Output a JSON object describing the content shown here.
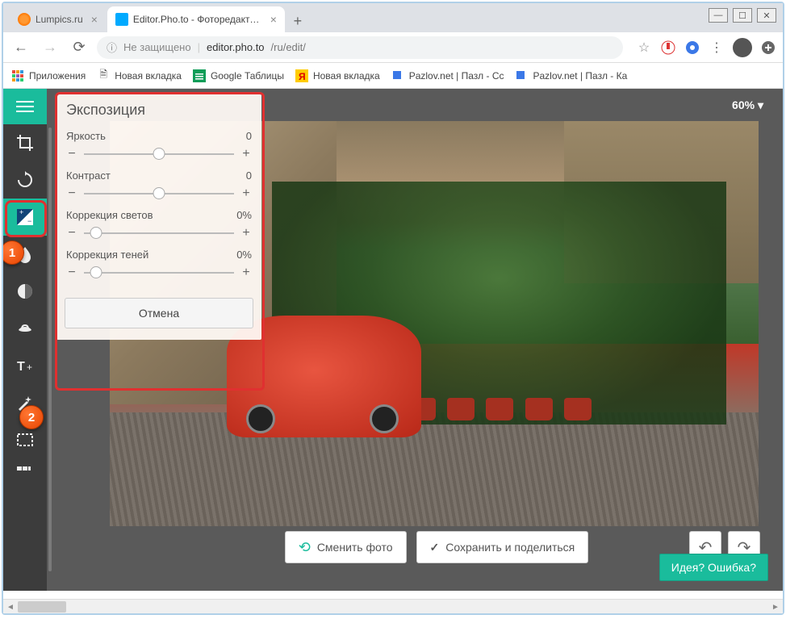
{
  "window": {
    "tabs": [
      {
        "title": "Lumpics.ru",
        "active": false
      },
      {
        "title": "Editor.Pho.to - Фоторедактор он",
        "active": true
      }
    ]
  },
  "browser": {
    "insecure_label": "Не защищено",
    "url_host": "editor.pho.to",
    "url_path": "/ru/edit/"
  },
  "bookmarks": {
    "apps": "Приложения",
    "items": [
      "Новая вкладка",
      "Google Таблицы",
      "Новая вкладка",
      "Pazlov.net | Пазл - Сс",
      "Pazlov.net | Пазл - Ка"
    ]
  },
  "editor": {
    "zoom": "60%",
    "panel": {
      "title": "Экспозиция",
      "sliders": [
        {
          "label": "Яркость",
          "value": "0",
          "thumb_pct": 50
        },
        {
          "label": "Контраст",
          "value": "0",
          "thumb_pct": 50
        },
        {
          "label": "Коррекция светов",
          "value": "0%",
          "thumb_pct": 8
        },
        {
          "label": "Коррекция теней",
          "value": "0%",
          "thumb_pct": 8
        }
      ],
      "cancel": "Отмена"
    },
    "actions": {
      "change_photo": "Сменить фото",
      "save_share": "Сохранить и поделиться"
    },
    "feedback": "Идея? Ошибка?"
  },
  "callouts": {
    "one": "1",
    "two": "2"
  }
}
